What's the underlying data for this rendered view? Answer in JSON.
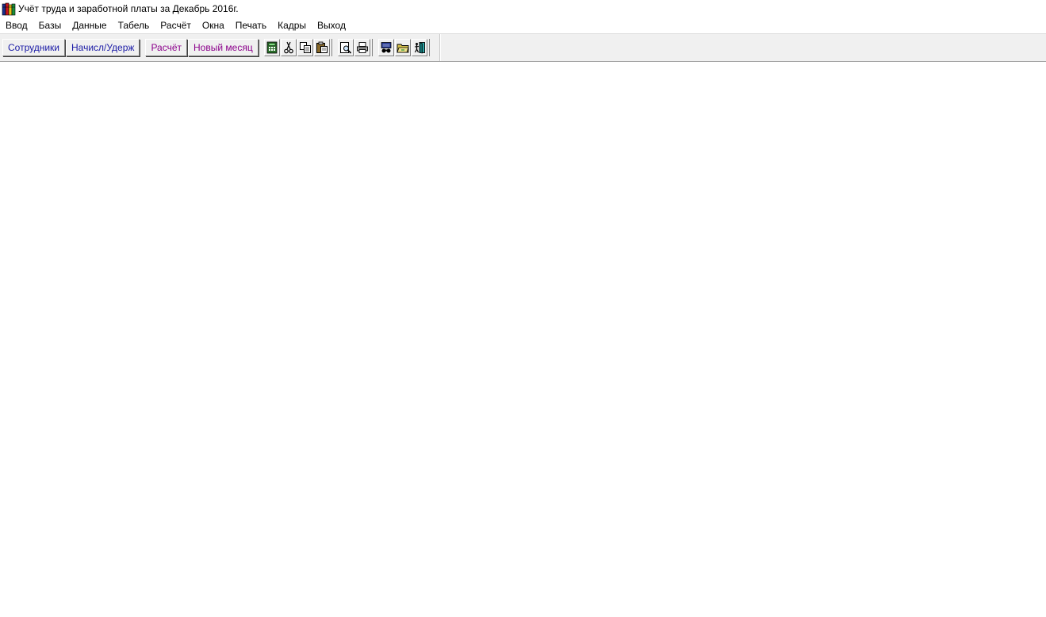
{
  "window": {
    "title": "Учёт труда и заработной платы за Декабрь 2016г.",
    "icon": "app-books-icon"
  },
  "menu": {
    "items": [
      {
        "label": "Ввод"
      },
      {
        "label": "Базы"
      },
      {
        "label": "Данные"
      },
      {
        "label": "Табель"
      },
      {
        "label": "Расчёт"
      },
      {
        "label": "Окна"
      },
      {
        "label": "Печать"
      },
      {
        "label": "Кадры"
      },
      {
        "label": "Выход"
      }
    ]
  },
  "toolbar": {
    "employees_label": "Сотрудники",
    "accruals_label": "Начисл/Удерж",
    "calc_label": "Расчёт",
    "new_month_label": "Новый месяц",
    "icons": [
      "calculator-icon",
      "cut-icon",
      "copy-icon",
      "paste-icon",
      "print-preview-icon",
      "print-icon",
      "find-icon",
      "folder-icon",
      "exit-door-icon"
    ],
    "colors": {
      "blue_text": "#1a1aa6",
      "purple_text": "#8b008b"
    }
  }
}
